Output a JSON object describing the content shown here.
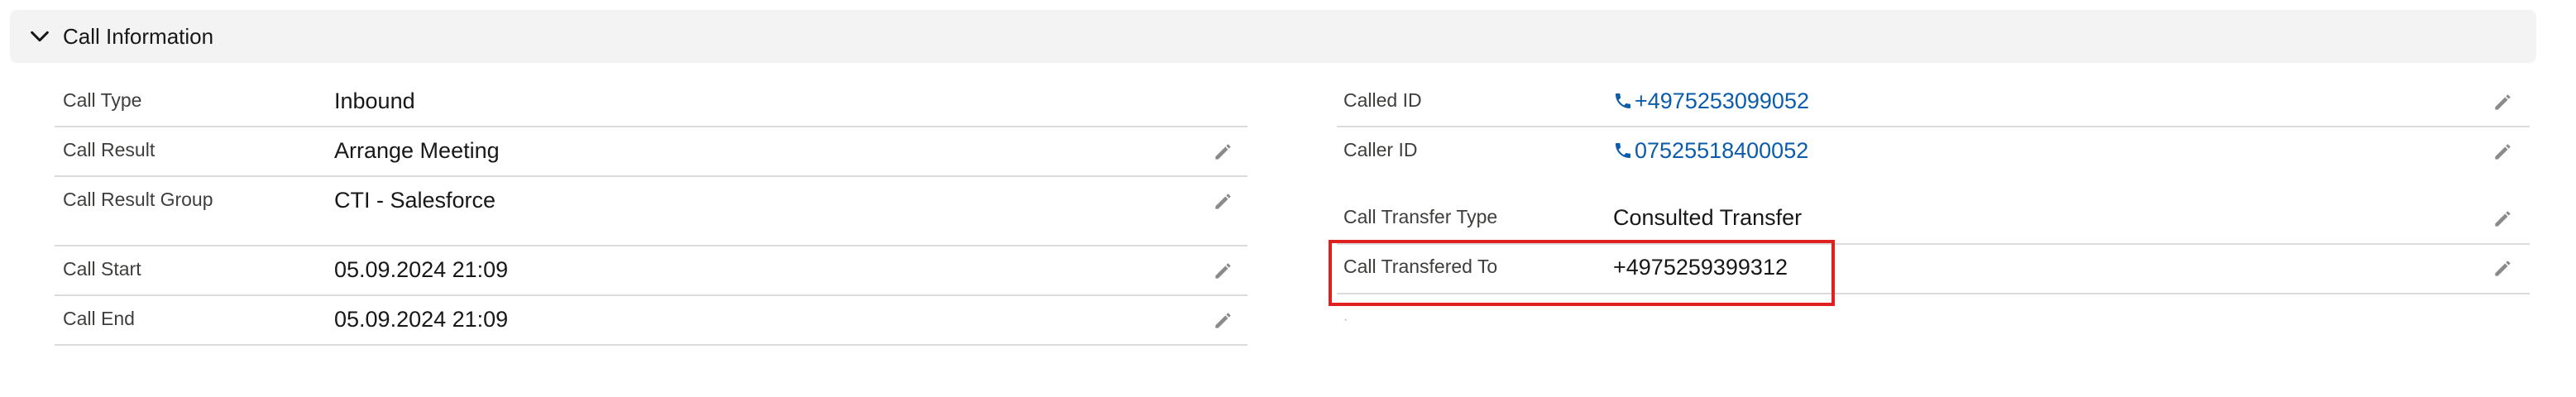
{
  "section": {
    "title": "Call Information",
    "expanded_icon": "chevron-down-icon"
  },
  "left_fields": [
    {
      "label": "Call Type",
      "value": "Inbound",
      "editable": false
    },
    {
      "label": "Call Result",
      "value": "Arrange Meeting",
      "editable": true
    },
    {
      "label": "Call Result Group",
      "value": "CTI - Salesforce",
      "editable": true
    },
    {
      "label": "Call Start",
      "value": "05.09.2024 21:09",
      "editable": true
    },
    {
      "label": "Call End",
      "value": "05.09.2024 21:09",
      "editable": true
    }
  ],
  "right_fields": [
    {
      "label": "Called ID",
      "value": "+4975253099052",
      "type": "phone",
      "editable": true
    },
    {
      "label": "Caller ID",
      "value": "07525518400052",
      "type": "phone",
      "editable": true
    },
    {
      "label": "Call Transfer Type",
      "value": "Consulted Transfer",
      "editable": true
    },
    {
      "label": "Call Transfered To",
      "value": "+4975259399312",
      "editable": true,
      "highlighted": true
    }
  ],
  "colors": {
    "link": "#0b5cab",
    "highlight": "#e0201e",
    "header_bg": "#f3f3f3",
    "divider": "#dddbda"
  },
  "icons": {
    "edit": "pencil-icon",
    "phone": "phone-icon"
  }
}
